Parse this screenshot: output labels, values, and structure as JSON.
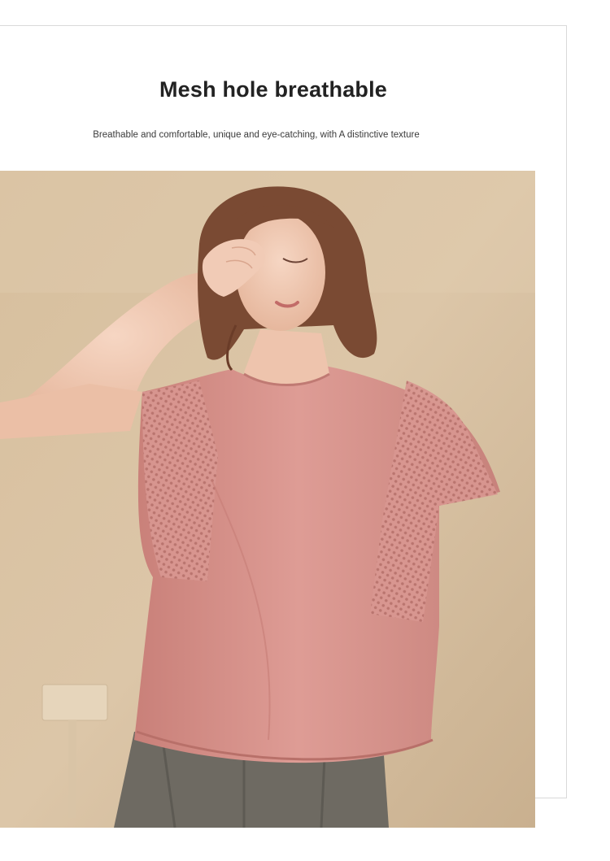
{
  "header": {
    "title": "Mesh hole breathable",
    "subtitle": "Breathable and comfortable, unique and eye-catching, with A distinctive texture"
  },
  "photo": {
    "subject": "woman-in-pink-mesh-tshirt",
    "colors": {
      "wall": "#d8c1a1",
      "shirt": "#d99590",
      "skirt": "#6e6a62",
      "hair": "#7a4a33",
      "skin": "#efc8b2"
    }
  }
}
